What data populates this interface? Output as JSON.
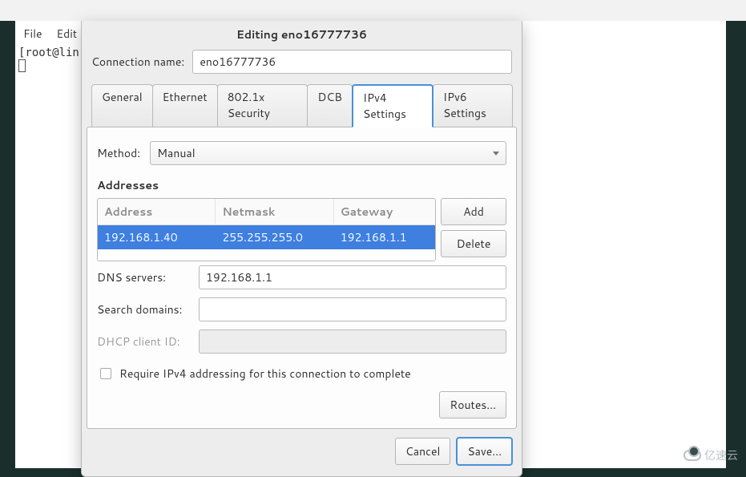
{
  "menubar": {
    "items": [
      "File",
      "Edit"
    ]
  },
  "terminal": {
    "prompt": "[root@lin"
  },
  "dialog": {
    "title": "Editing eno16777736",
    "connection_name_label": "Connection name:",
    "connection_name_value": "eno16777736",
    "tabs": [
      "General",
      "Ethernet",
      "802.1x Security",
      "DCB",
      "IPv4 Settings",
      "IPv6 Settings"
    ],
    "active_tab_index": 4,
    "method_label": "Method:",
    "method_value": "Manual",
    "addresses_label": "Addresses",
    "columns": {
      "address": "Address",
      "netmask": "Netmask",
      "gateway": "Gateway"
    },
    "rows": [
      {
        "address": "192.168.1.40",
        "netmask": "255.255.255.0",
        "gateway": "192.168.1.1"
      }
    ],
    "buttons": {
      "add": "Add",
      "delete": "Delete",
      "routes": "Routes...",
      "cancel": "Cancel",
      "save": "Save..."
    },
    "dns_label": "DNS servers:",
    "dns_value": "192.168.1.1",
    "search_label": "Search domains:",
    "search_value": "",
    "dhcp_label": "DHCP client ID:",
    "dhcp_value": "",
    "require_label": "Require IPv4 addressing for this connection to complete",
    "require_checked": false
  },
  "watermark": "亿速云"
}
